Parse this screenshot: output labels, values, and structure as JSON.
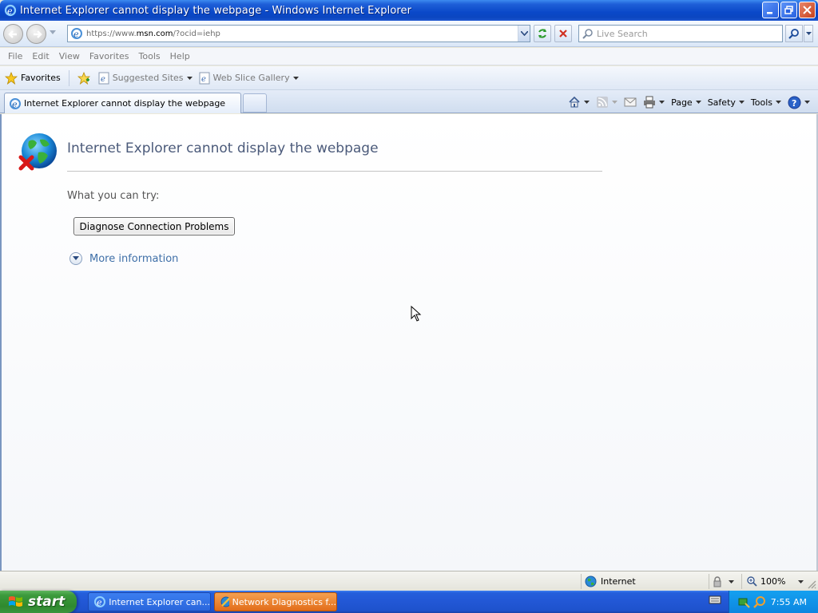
{
  "window": {
    "title": "Internet Explorer cannot display the webpage - Windows Internet Explorer"
  },
  "address": {
    "url_prefix": "https://www.",
    "url_domain": "msn.com",
    "url_suffix": "/?ocid=iehp"
  },
  "search": {
    "placeholder": "Live Search"
  },
  "menu": {
    "file": "File",
    "edit": "Edit",
    "view": "View",
    "favorites": "Favorites",
    "tools": "Tools",
    "help": "Help"
  },
  "favorites_bar": {
    "favorites": "Favorites",
    "suggested_sites": "Suggested Sites",
    "web_slice_gallery": "Web Slice Gallery"
  },
  "tab": {
    "label": "Internet Explorer cannot display the webpage"
  },
  "command_bar": {
    "page": "Page",
    "safety": "Safety",
    "tools": "Tools"
  },
  "content": {
    "title": "Internet Explorer cannot display the webpage",
    "what_you_can_try": "What you can try:",
    "diagnose_button": "Diagnose Connection Problems",
    "more_information": "More information"
  },
  "status": {
    "zone": "Internet",
    "zoom": "100%"
  },
  "taskbar": {
    "start": "start",
    "task1": "Internet Explorer can...",
    "task2": "Network Diagnostics f...",
    "clock": "7:55 AM"
  },
  "colors": {
    "title_bar": "#0a48c8",
    "taskbar": "#2257d5",
    "start_button": "#3c9a3c",
    "link": "#3f6fa8",
    "error_title": "#4b5a7a"
  }
}
